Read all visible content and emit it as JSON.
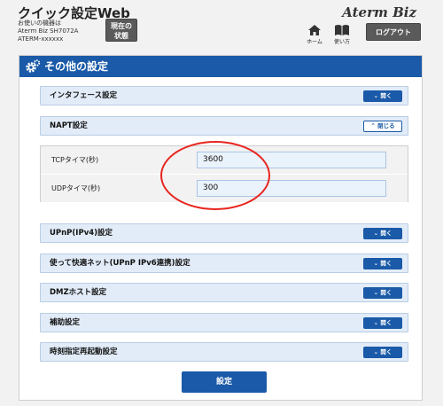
{
  "header": {
    "title": "クイック設定Web",
    "device_lines": [
      "お使いの機器は",
      "Aterm Biz SH7072A",
      "ATERM-xxxxxx"
    ],
    "status_button": "現在の状態",
    "brand": "Aterm Biz",
    "home_label": "ホーム",
    "help_label": "使い方",
    "logout_button": "ログアウト"
  },
  "panel": {
    "title": "その他の設定",
    "sections": [
      {
        "title": "インタフェース設定",
        "toggle": "開く",
        "state": "collapsed"
      },
      {
        "title": "NAPT設定",
        "toggle": "閉じる",
        "state": "expanded"
      },
      {
        "title": "UPnP(IPv4)設定",
        "toggle": "開く",
        "state": "collapsed"
      },
      {
        "title": "使って快適ネット(UPnP IPv6連携)設定",
        "toggle": "開く",
        "state": "collapsed"
      },
      {
        "title": "DMZホスト設定",
        "toggle": "開く",
        "state": "collapsed"
      },
      {
        "title": "補助設定",
        "toggle": "開く",
        "state": "collapsed"
      },
      {
        "title": "時刻指定再起動設定",
        "toggle": "開く",
        "state": "collapsed"
      }
    ],
    "napt": {
      "tcp_label": "TCPタイマ(秒)",
      "tcp_value": "3600",
      "udp_label": "UDPタイマ(秒)",
      "udp_value": "300"
    },
    "submit": "設定"
  },
  "colors": {
    "accent": "#1a5aa8",
    "annotation": "#e8251f",
    "section_bg": "#e2ecf8"
  }
}
